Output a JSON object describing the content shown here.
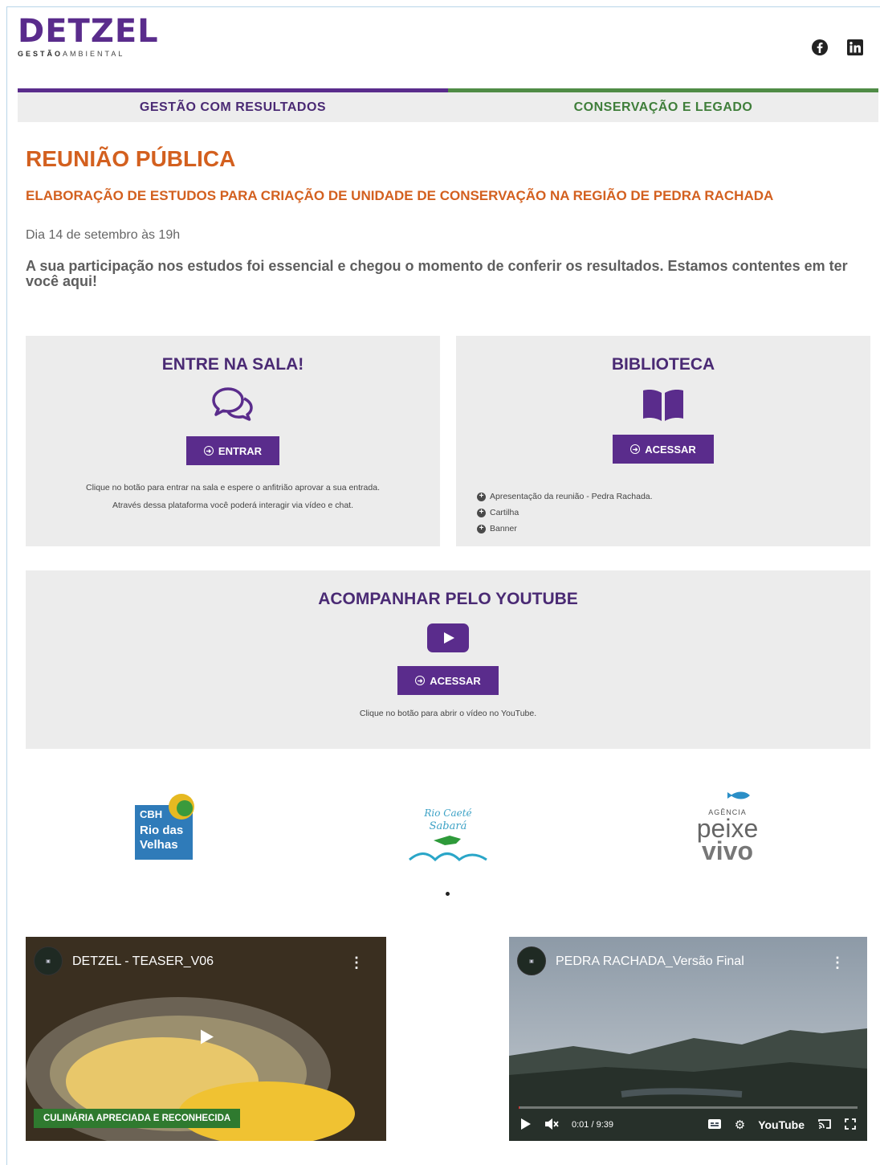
{
  "brand": {
    "name": "DETZEL",
    "tagline_bold": "GESTÃO",
    "tagline_rest": "AMBIENTAL"
  },
  "social": {
    "icons": [
      "facebook-icon",
      "linkedin-icon"
    ]
  },
  "nav": {
    "left": "GESTÃO COM RESULTADOS",
    "right": "CONSERVAÇÃO E LEGADO"
  },
  "intro": {
    "title": "REUNIÃO PÚBLICA",
    "subtitle": "ELABORAÇÃO DE ESTUDOS PARA CRIAÇÃO DE UNIDADE DE CONSERVAÇÃO NA REGIÃO DE PEDRA RACHADA",
    "date": "Dia 14 de setembro às 19h",
    "lead": "A sua participação nos estudos foi essencial e chegou o momento de conferir os resultados. Estamos contentes em ter você aqui!"
  },
  "room": {
    "title": "ENTRE NA SALA!",
    "button": "ENTRAR",
    "note_line1": "Clique no botão para entrar na sala e espere o anfitrião aprovar a sua entrada.",
    "note_line2": "Através dessa plataforma você poderá interagir via vídeo e chat."
  },
  "library": {
    "title": "BIBLIOTECA",
    "button": "ACESSAR",
    "items": [
      "Apresentação da reunião - Pedra Rachada.",
      "Cartilha",
      "Banner"
    ]
  },
  "youtube": {
    "title": "ACOMPANHAR PELO YOUTUBE",
    "button": "ACESSAR",
    "note": "Clique no botão para abrir o vídeo no YouTube."
  },
  "partners": {
    "cbh": {
      "l1": "CBH",
      "l2": "Rio das",
      "l3": "Velhas"
    },
    "caete": {
      "l1": "Rio Caeté",
      "l2": "Sabará"
    },
    "peixe": {
      "l1": "AGÊNCIA",
      "l2": "peixe",
      "l3": "vivo"
    }
  },
  "videos": [
    {
      "title": "DETZEL - TEASER_V06",
      "badge": "CULINÁRIA APRECIADA E RECONHECIDA"
    },
    {
      "title": "PEDRA RACHADA_Versão Final",
      "time": "0:01 / 9:39",
      "brand": "YouTube",
      "progress": 0.002
    }
  ],
  "colors": {
    "purple": "#5a2c8c",
    "orange": "#d3601f",
    "green": "#4f8c46",
    "card_bg": "#ececec"
  }
}
